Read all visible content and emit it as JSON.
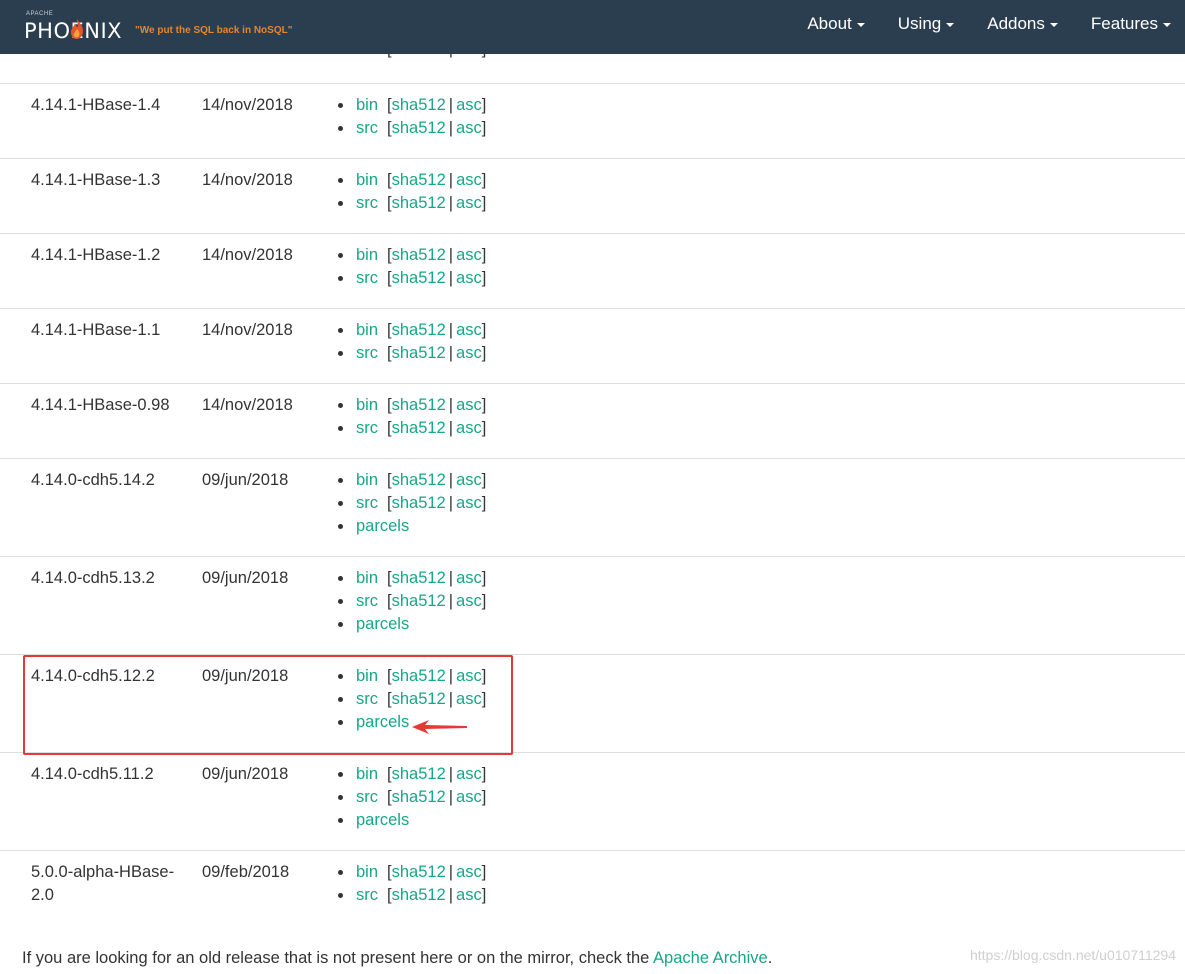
{
  "navbar": {
    "brand_apache": "APACHE",
    "brand_name": "PHOENIX",
    "tagline": "\"We put the SQL back in NoSQL\"",
    "items": [
      {
        "label": "About"
      },
      {
        "label": "Using"
      },
      {
        "label": "Addons"
      },
      {
        "label": "Features"
      }
    ]
  },
  "link_labels": {
    "bin": "bin",
    "src": "src",
    "sha512": "sha512",
    "asc": "asc",
    "parcels": "parcels",
    "bracket_open": "[",
    "bracket_close": "]",
    "separator": "|"
  },
  "releases": [
    {
      "version": "4.14.1-HBase-1.4",
      "date": "14/nov/2018"
    },
    {
      "version": "4.14.1-HBase-1.3",
      "date": "14/nov/2018"
    },
    {
      "version": "4.14.1-HBase-1.2",
      "date": "14/nov/2018"
    },
    {
      "version": "4.14.1-HBase-1.1",
      "date": "14/nov/2018"
    },
    {
      "version": "4.14.1-HBase-0.98",
      "date": "14/nov/2018"
    },
    {
      "version": "4.14.0-cdh5.14.2",
      "date": "09/jun/2018"
    },
    {
      "version": "4.14.0-cdh5.13.2",
      "date": "09/jun/2018"
    },
    {
      "version": "4.14.0-cdh5.12.2",
      "date": "09/jun/2018"
    },
    {
      "version": "4.14.0-cdh5.11.2",
      "date": "09/jun/2018"
    },
    {
      "version": "5.0.0-alpha-HBase-2.0",
      "date": "09/feb/2018"
    }
  ],
  "footer": {
    "text": "If you are looking for an old release that is not present here or on the mirror, check the",
    "link": "Apache Archive",
    "period": "."
  },
  "watermark": "https://blog.csdn.net/u010711294",
  "colors": {
    "navbar_bg": "#2b3e50",
    "link": "#18a689",
    "tagline": "#e5862a",
    "highlight": "#e53935"
  }
}
